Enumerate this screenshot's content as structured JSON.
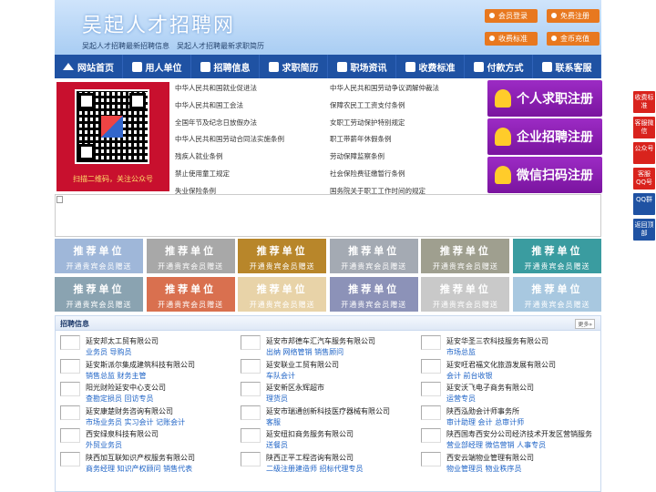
{
  "header": {
    "title": "吴起人才招聘网",
    "subtitle": "吴起人才招聘最新招聘信息　吴起人才招聘最新求职简历",
    "buttons": [
      "会员登录",
      "免费注册",
      "收费标准",
      "金币充值"
    ]
  },
  "nav": [
    "网站首页",
    "用人单位",
    "招聘信息",
    "求职简历",
    "职场资讯",
    "收费标准",
    "付款方式",
    "联系客服"
  ],
  "qr": {
    "caption": "扫描二维码，关注公众号"
  },
  "laws": [
    "中华人民共和国就业促进法",
    "中华人民共和国劳动争议调解仲裁法",
    "中华人民共和国工会法",
    "保障农民工工资支付条例",
    "全国年节及纪念日放假办法",
    "女职工劳动保护特别规定",
    "中华人民共和国劳动合同法实施条例",
    "职工带薪年休假条例",
    "残疾人就业条例",
    "劳动保障监察条例",
    "禁止使用童工规定",
    "社会保险费征缴暂行条例",
    "失业保险条例",
    "国务院关于职工工作时间的规定"
  ],
  "register": [
    "个人求职注册",
    "企业招聘注册",
    "微信扫码注册"
  ],
  "promos": {
    "title": "推荐单位",
    "sub": "开通贵宾会员赠送",
    "colors": [
      "#9fb7d9",
      "#a8a8a8",
      "#b8862a",
      "#a4aab3",
      "#9f9f8f",
      "#3a9ca0",
      "#8aa3b1",
      "#d9704f",
      "#e8d3a8",
      "#8c92b8",
      "#c9c9c9",
      "#a8c8e0"
    ]
  },
  "jobs": {
    "heading": "招聘信息",
    "more": "更多»",
    "items": [
      {
        "name": "延安邦太工贸有限公司",
        "tags": "业务员 导购员"
      },
      {
        "name": "延安市邦德车汇汽车服务有限公司",
        "tags": "出纳 网络管销 销售顾问"
      },
      {
        "name": "延安华圣三农科技服务有限公司",
        "tags": "市场总监"
      },
      {
        "name": "延安斯派尔集成建筑科技有限公司",
        "tags": "销售总监 财务主管"
      },
      {
        "name": "延安联业工贸有限公司",
        "tags": "车队会计"
      },
      {
        "name": "延安旺君福文化旅游发展有限公司",
        "tags": "会计 前台收银"
      },
      {
        "name": "阳光财险延安中心支公司",
        "tags": "查勘定损员 回访专员"
      },
      {
        "name": "延安新区永辉超市",
        "tags": "理货员"
      },
      {
        "name": "延安沃飞电子商务有限公司",
        "tags": "运营专员"
      },
      {
        "name": "延安康楚财务咨询有限公司",
        "tags": "市场业务员 实习会计 记账会计"
      },
      {
        "name": "延安市瑞通创新科技医疗器械有限公司",
        "tags": "客服"
      },
      {
        "name": "陕西泓勋会计师事务所",
        "tags": "审计助理 会计 总审计师"
      },
      {
        "name": "西安绿泉科技有限公司",
        "tags": "外贸业务员"
      },
      {
        "name": "延安纽扣商务服务有限公司",
        "tags": "送餐员"
      },
      {
        "name": "陕西国寿西安分公司经济技术开发区营销服务",
        "tags": "营业部经理 微信营销 人事专员"
      },
      {
        "name": "陕西加互联知识产权服务有限公司",
        "tags": "商务经理 知识产权顾问 销售代表"
      },
      {
        "name": "陕西正平工程咨询有限公司",
        "tags": "二级注册建造师 招标代理专员"
      },
      {
        "name": "西安云端物业管理有限公司",
        "tags": "物业管理员 物业秩序员"
      }
    ]
  },
  "side": [
    {
      "l": "收费标准",
      "c": "#d9231d"
    },
    {
      "l": "客服微信",
      "c": "#d9231d"
    },
    {
      "l": "公众号",
      "c": "#d9231d"
    },
    {
      "l": "客服QQ号",
      "c": "#d9231d"
    },
    {
      "l": "QQ群",
      "c": "#1f52a3"
    },
    {
      "l": "返回顶部",
      "c": "#1f52a3"
    }
  ]
}
